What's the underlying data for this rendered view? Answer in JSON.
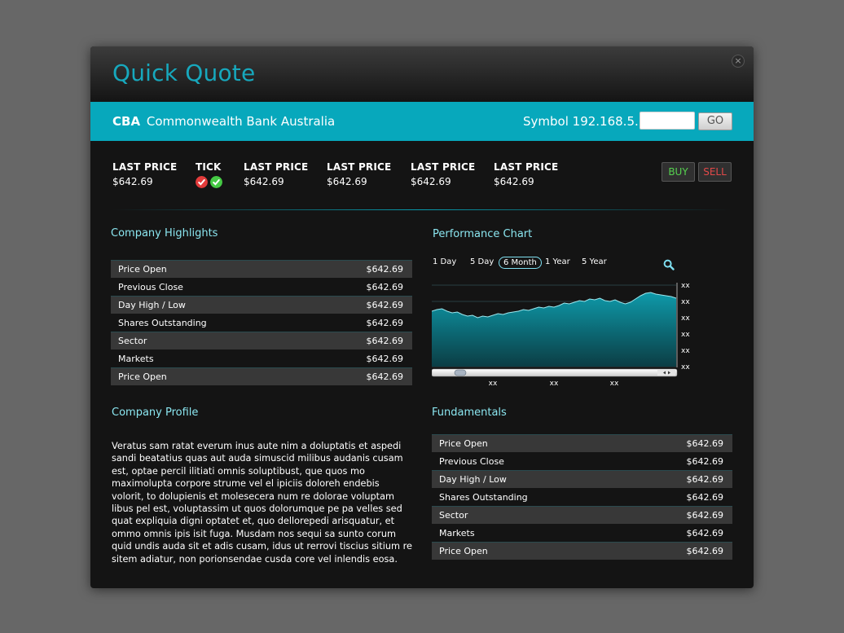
{
  "title": "Quick Quote",
  "close_glyph": "×",
  "company": {
    "ticker": "CBA",
    "name": "Commonwealth Bank Australia"
  },
  "symbol": {
    "label": "Symbol 192.168.5.12",
    "input_value": "",
    "go_label": "GO"
  },
  "prices": [
    {
      "label": "LAST PRICE",
      "value": "$642.69"
    },
    {
      "label": "TICK"
    },
    {
      "label": "LAST PRICE",
      "value": "$642.69"
    },
    {
      "label": "LAST PRICE",
      "value": "$642.69"
    },
    {
      "label": "LAST PRICE",
      "value": "$642.69"
    },
    {
      "label": "LAST PRICE",
      "value": "$642.69"
    }
  ],
  "tick_icons": [
    "x-circle-red",
    "check-circle-green"
  ],
  "actions": {
    "buy": "BUY",
    "sell": "SELL"
  },
  "highlights": {
    "title": "Company Highlights",
    "rows": [
      {
        "label": "Price Open",
        "value": "$642.69"
      },
      {
        "label": "Previous Close",
        "value": "$642.69"
      },
      {
        "label": "Day High / Low",
        "value": "$642.69"
      },
      {
        "label": "Shares Outstanding",
        "value": "$642.69"
      },
      {
        "label": "Sector",
        "value": "$642.69"
      },
      {
        "label": "Markets",
        "value": "$642.69"
      },
      {
        "label": "Price Open",
        "value": "$642.69"
      }
    ]
  },
  "profile": {
    "title": "Company Profile",
    "text": "Veratus sam ratat everum inus aute nim a doluptatis et aspedi sandi beatatius quas aut auda simuscid milibus audanis cusam est, optae percil ilitiati omnis soluptibust, que quos mo maximolupta corpore strume vel el ipiciis doloreh endebis volorit, to dolupienis et molesecera num re dolorae voluptam libus pel est, voluptassim ut quos dolorumque pe pa velles sed quat expliquia digni optatet et, quo dellorepedi arisquatur, et ommo omnis ipis isit fuga. Musdam nos sequi sa sunto corum quid undis auda sit et adis cusam, idus ut rerrovi tiscius sitium re sitem adiatur, non porionsendae cusda core vel inlendis eosa."
  },
  "performance": {
    "title": "Performance Chart",
    "ranges": [
      "1 Day",
      "5 Day",
      "6 Month",
      "1 Year",
      "5 Year"
    ],
    "active_range": "6 Month"
  },
  "fundamentals": {
    "title": "Fundamentals",
    "rows": [
      {
        "label": "Price Open",
        "value": "$642.69"
      },
      {
        "label": "Previous Close",
        "value": "$642.69"
      },
      {
        "label": "Day High / Low",
        "value": "$642.69"
      },
      {
        "label": "Shares Outstanding",
        "value": "$642.69"
      },
      {
        "label": "Sector",
        "value": "$642.69"
      },
      {
        "label": "Markets",
        "value": "$642.69"
      },
      {
        "label": "Price Open",
        "value": "$642.69"
      }
    ]
  },
  "chart_data": {
    "type": "area",
    "x_tick_labels": [
      "xx",
      "xx",
      "xx"
    ],
    "y_tick_labels": [
      "xx",
      "xx",
      "xx",
      "xx",
      "xx",
      "xx"
    ],
    "ylim": [
      0,
      100
    ],
    "grid": true,
    "values": [
      68,
      70,
      71,
      68,
      66,
      67,
      64,
      62,
      63,
      60,
      62,
      61,
      63,
      65,
      64,
      66,
      67,
      68,
      70,
      69,
      71,
      73,
      72,
      74,
      73,
      75,
      78,
      77,
      79,
      81,
      80,
      83,
      82,
      84,
      81,
      80,
      82,
      79,
      77,
      79,
      83,
      87,
      90,
      91,
      89,
      88,
      87,
      86,
      84
    ]
  },
  "colors": {
    "accent": "#07a8bc",
    "title": "#17a8bd",
    "section": "#8be6f0",
    "buy": "#56d24f",
    "sell": "#e34949"
  }
}
